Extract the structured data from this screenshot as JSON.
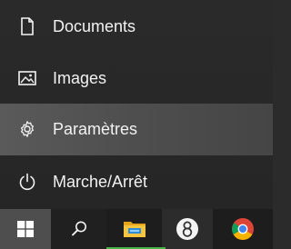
{
  "start_menu": {
    "items": [
      {
        "label": "Documents",
        "icon": "document-icon"
      },
      {
        "label": "Images",
        "icon": "image-icon"
      },
      {
        "label": "Paramètres",
        "icon": "gear-icon"
      },
      {
        "label": "Marche/Arrêt",
        "icon": "power-icon"
      }
    ],
    "highlighted_item": "Paramètres"
  },
  "taskbar": {
    "buttons": [
      {
        "icon": "windows-logo-icon",
        "state": "active"
      },
      {
        "icon": "search-icon"
      },
      {
        "icon": "file-explorer-icon",
        "running": true
      },
      {
        "icon": "app-8-icon",
        "running": true
      },
      {
        "icon": "chrome-icon"
      }
    ]
  },
  "colors": {
    "menu_background": "#2a2a2a",
    "highlight": "#555555",
    "taskbar_background": "#1d1d1d",
    "start_button_active": "#4e4e4e",
    "running_indicator": "#48b548",
    "text": "#f2f2f2"
  }
}
